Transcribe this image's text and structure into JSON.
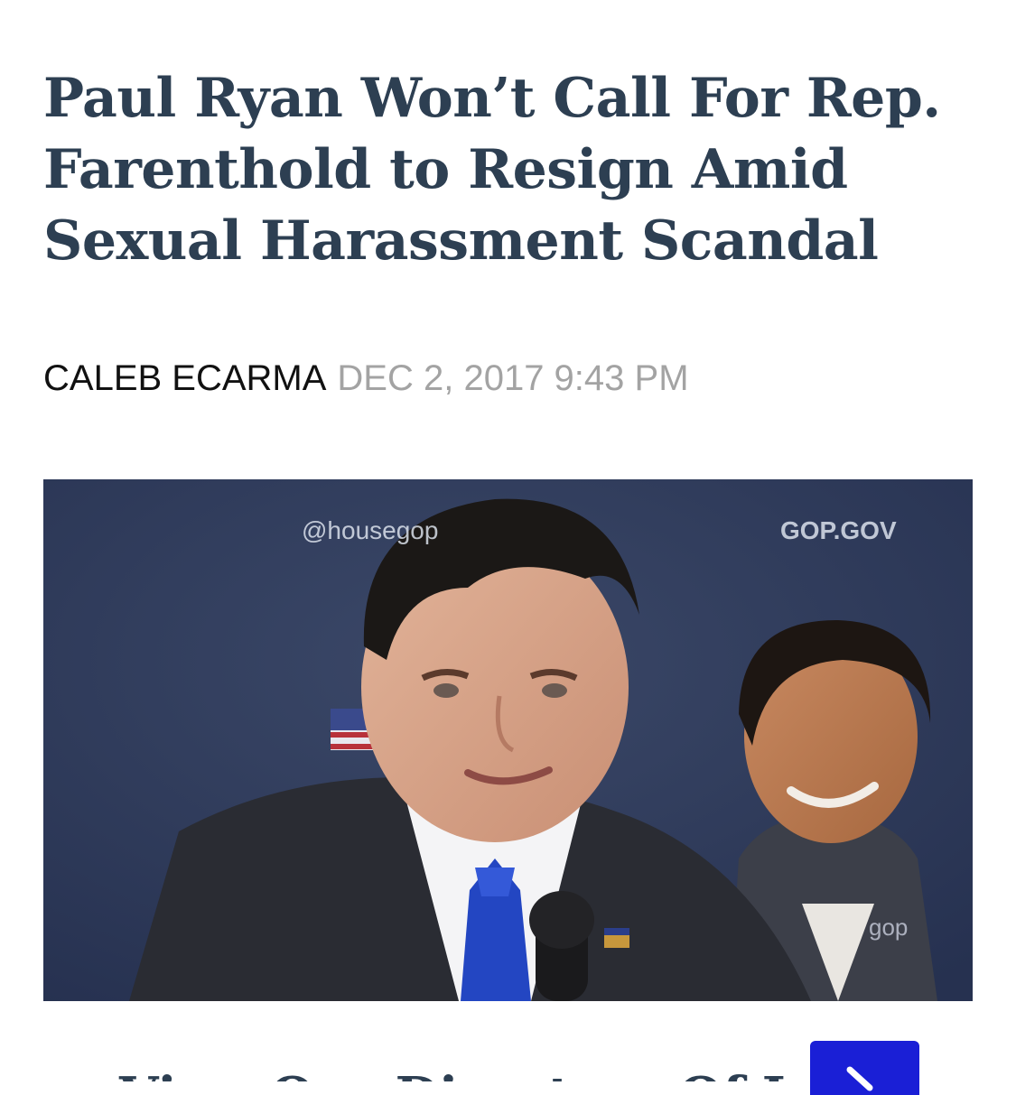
{
  "article": {
    "headline": "Paul Ryan Won’t Call For Rep. Farenthold to Resign Amid Sexual Harassment Scandal",
    "author": "CALEB ECARMA",
    "date": "DEC 2, 2017 9:43 PM"
  },
  "photo": {
    "backdrop_handle": "@housegop",
    "backdrop_site": "GOP.GOV",
    "backdrop_repeat": "gop"
  },
  "teaser": {
    "text": "View Our Directory Of Lawmakers"
  },
  "icons": {
    "next": "chevron-right-icon"
  },
  "colors": {
    "headline": "#2d3f52",
    "author": "#111111",
    "date": "#a3a3a3",
    "button": "#1a1fd6"
  }
}
